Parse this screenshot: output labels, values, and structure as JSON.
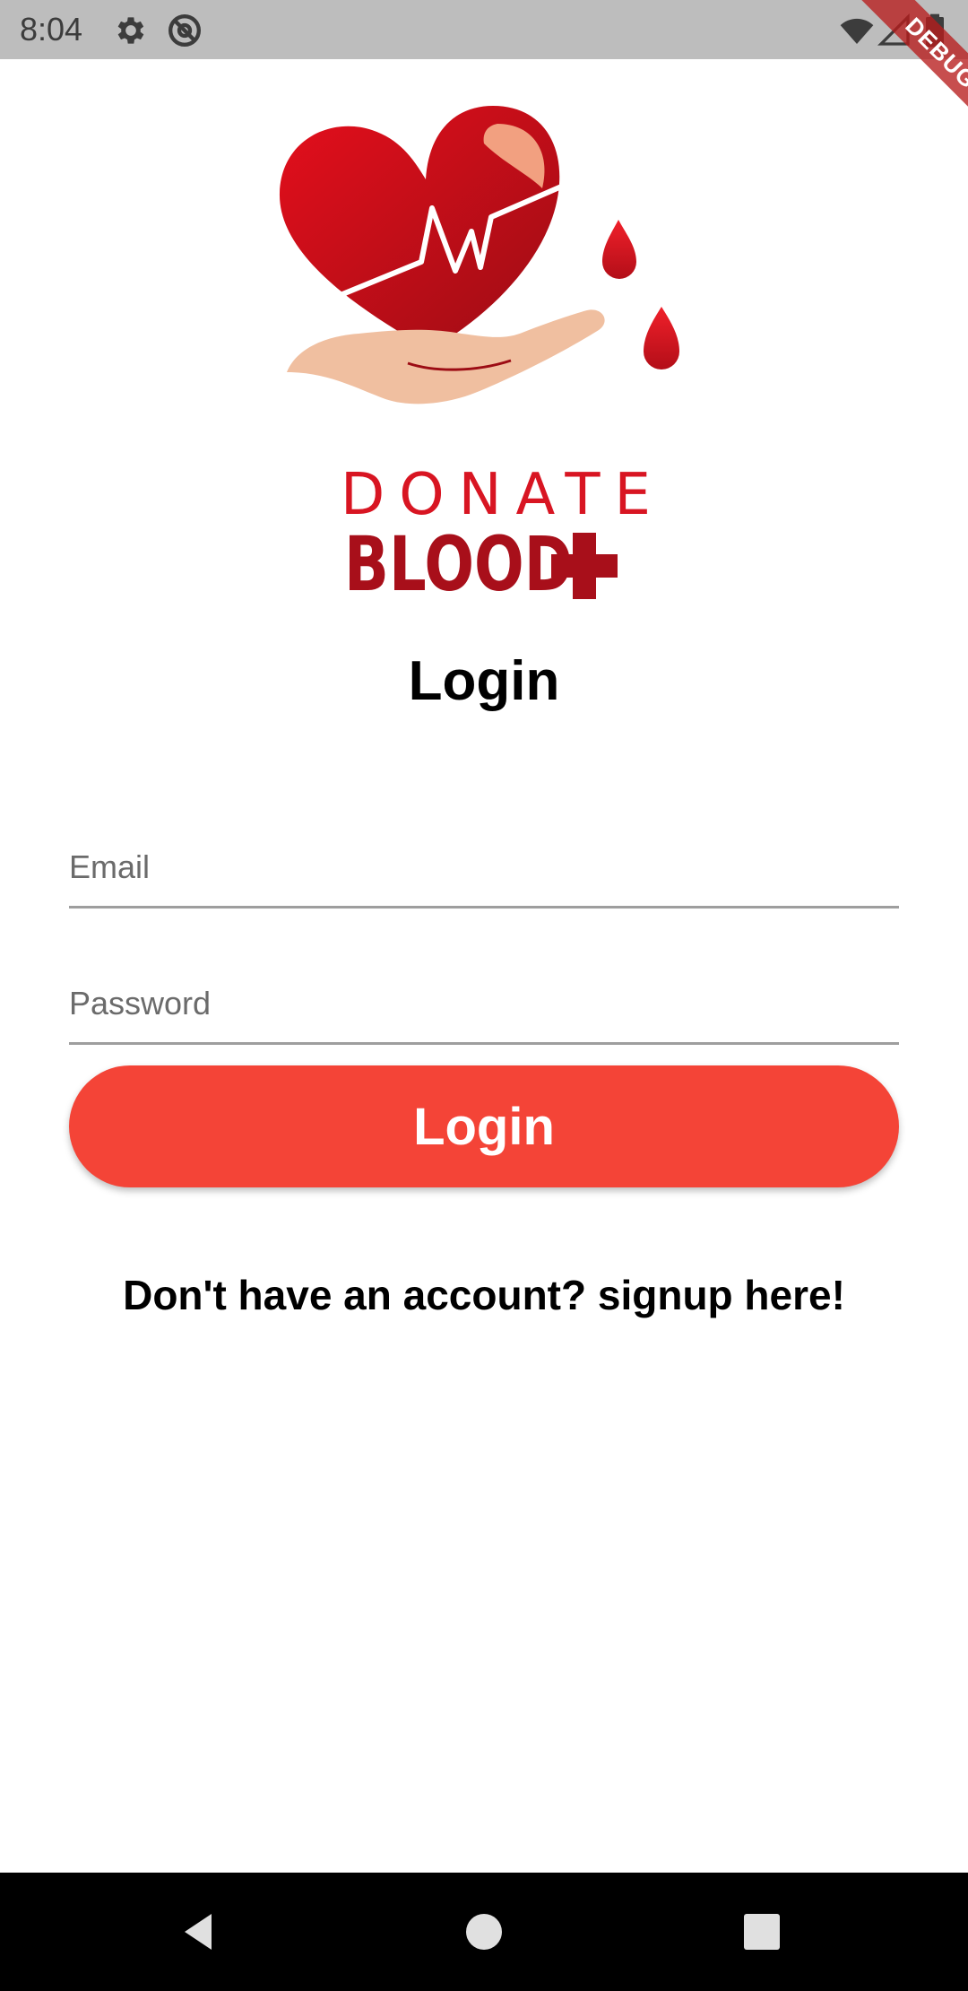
{
  "status_bar": {
    "time": "8:04",
    "icons": [
      "gear-icon",
      "at-sign-icon",
      "wifi-icon",
      "signal-icon",
      "battery-icon"
    ],
    "debug_label": "DEBUG"
  },
  "logo": {
    "word_top": "DONATE",
    "word_bottom": "BLOOD",
    "icons": [
      "heart-in-hand-icon",
      "blood-drop-icon",
      "medical-cross-icon"
    ],
    "colors": {
      "primary_red": "#d81522",
      "dark_red": "#a80f1a",
      "hand": "#f0bfa0"
    }
  },
  "form": {
    "title": "Login",
    "email": {
      "placeholder": "Email",
      "value": ""
    },
    "password": {
      "placeholder": "Password",
      "value": ""
    },
    "login_button_label": "Login",
    "signup_text": "Don't have an account? signup here!"
  },
  "nav_bar": {
    "icons": [
      "back-triangle-icon",
      "home-circle-icon",
      "recents-square-icon"
    ]
  },
  "theme": {
    "accent": "#f44437",
    "status_bar_bg": "#bdbdbd",
    "nav_bar_bg": "#000000"
  }
}
